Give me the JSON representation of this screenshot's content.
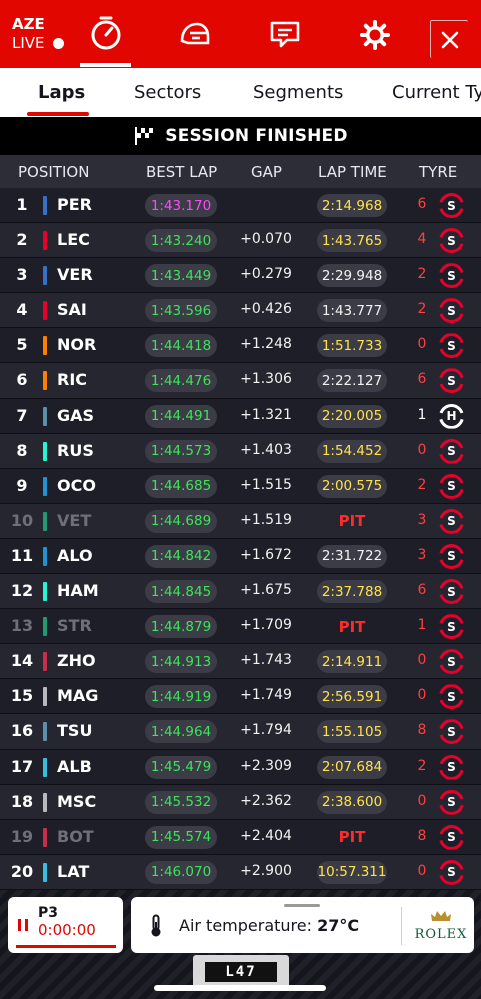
{
  "topbar": {
    "brand": "AZE",
    "live": "LIVE",
    "icons": [
      "timer-icon",
      "helmet-icon",
      "chat-icon",
      "gear-icon",
      "close-icon"
    ]
  },
  "tabs": [
    "Laps",
    "Sectors",
    "Segments",
    "Current Tyr"
  ],
  "banner": {
    "text": "SESSION FINISHED"
  },
  "table": {
    "headers": {
      "position": "POSITION",
      "best_lap": "BEST LAP",
      "gap": "GAP",
      "lap_time": "LAP TIME",
      "tyre": "TYRE"
    },
    "rows": [
      {
        "pos": "1",
        "code": "PER",
        "color": "#3671c6",
        "best": "1:43.170",
        "best_fastest": true,
        "gap": "",
        "lap": "2:14.968",
        "lap_pb": true,
        "pit": false,
        "age": "6",
        "tyre": "S",
        "dim": false
      },
      {
        "pos": "2",
        "code": "LEC",
        "color": "#e8002d",
        "best": "1:43.240",
        "best_fastest": false,
        "gap": "+0.070",
        "lap": "1:43.765",
        "lap_pb": true,
        "pit": false,
        "age": "4",
        "tyre": "S",
        "dim": false
      },
      {
        "pos": "3",
        "code": "VER",
        "color": "#3671c6",
        "best": "1:43.449",
        "best_fastest": false,
        "gap": "+0.279",
        "lap": "2:29.948",
        "lap_pb": false,
        "pit": false,
        "age": "2",
        "tyre": "S",
        "dim": false
      },
      {
        "pos": "4",
        "code": "SAI",
        "color": "#e8002d",
        "best": "1:43.596",
        "best_fastest": false,
        "gap": "+0.426",
        "lap": "1:43.777",
        "lap_pb": false,
        "pit": false,
        "age": "2",
        "tyre": "S",
        "dim": false
      },
      {
        "pos": "5",
        "code": "NOR",
        "color": "#ff8000",
        "best": "1:44.418",
        "best_fastest": false,
        "gap": "+1.248",
        "lap": "1:51.733",
        "lap_pb": true,
        "pit": false,
        "age": "0",
        "tyre": "S",
        "dim": false
      },
      {
        "pos": "6",
        "code": "RIC",
        "color": "#ff8000",
        "best": "1:44.476",
        "best_fastest": false,
        "gap": "+1.306",
        "lap": "2:22.127",
        "lap_pb": false,
        "pit": false,
        "age": "6",
        "tyre": "S",
        "dim": false
      },
      {
        "pos": "7",
        "code": "GAS",
        "color": "#5e8faa",
        "best": "1:44.491",
        "best_fastest": false,
        "gap": "+1.321",
        "lap": "2:20.005",
        "lap_pb": true,
        "pit": false,
        "age": "1",
        "tyre": "H",
        "dim": false
      },
      {
        "pos": "8",
        "code": "RUS",
        "color": "#27f4d2",
        "best": "1:44.573",
        "best_fastest": false,
        "gap": "+1.403",
        "lap": "1:54.452",
        "lap_pb": true,
        "pit": false,
        "age": "0",
        "tyre": "S",
        "dim": false
      },
      {
        "pos": "9",
        "code": "OCO",
        "color": "#2293d1",
        "best": "1:44.685",
        "best_fastest": false,
        "gap": "+1.515",
        "lap": "2:00.575",
        "lap_pb": true,
        "pit": false,
        "age": "2",
        "tyre": "S",
        "dim": false
      },
      {
        "pos": "10",
        "code": "VET",
        "color": "#229971",
        "best": "1:44.689",
        "best_fastest": false,
        "gap": "+1.519",
        "lap": "PIT",
        "lap_pb": false,
        "pit": true,
        "age": "3",
        "tyre": "S",
        "dim": true
      },
      {
        "pos": "11",
        "code": "ALO",
        "color": "#2293d1",
        "best": "1:44.842",
        "best_fastest": false,
        "gap": "+1.672",
        "lap": "2:31.722",
        "lap_pb": false,
        "pit": false,
        "age": "3",
        "tyre": "S",
        "dim": false
      },
      {
        "pos": "12",
        "code": "HAM",
        "color": "#27f4d2",
        "best": "1:44.845",
        "best_fastest": false,
        "gap": "+1.675",
        "lap": "2:37.788",
        "lap_pb": true,
        "pit": false,
        "age": "6",
        "tyre": "S",
        "dim": false
      },
      {
        "pos": "13",
        "code": "STR",
        "color": "#229971",
        "best": "1:44.879",
        "best_fastest": false,
        "gap": "+1.709",
        "lap": "PIT",
        "lap_pb": false,
        "pit": true,
        "age": "1",
        "tyre": "S",
        "dim": true
      },
      {
        "pos": "14",
        "code": "ZHO",
        "color": "#c92d4b",
        "best": "1:44.913",
        "best_fastest": false,
        "gap": "+1.743",
        "lap": "2:14.911",
        "lap_pb": true,
        "pit": false,
        "age": "0",
        "tyre": "S",
        "dim": false
      },
      {
        "pos": "15",
        "code": "MAG",
        "color": "#b6babd",
        "best": "1:44.919",
        "best_fastest": false,
        "gap": "+1.749",
        "lap": "2:56.591",
        "lap_pb": true,
        "pit": false,
        "age": "0",
        "tyre": "S",
        "dim": false
      },
      {
        "pos": "16",
        "code": "TSU",
        "color": "#5e8faa",
        "best": "1:44.964",
        "best_fastest": false,
        "gap": "+1.794",
        "lap": "1:55.105",
        "lap_pb": true,
        "pit": false,
        "age": "8",
        "tyre": "S",
        "dim": false
      },
      {
        "pos": "17",
        "code": "ALB",
        "color": "#37bedd",
        "best": "1:45.479",
        "best_fastest": false,
        "gap": "+2.309",
        "lap": "2:07.684",
        "lap_pb": true,
        "pit": false,
        "age": "2",
        "tyre": "S",
        "dim": false
      },
      {
        "pos": "18",
        "code": "MSC",
        "color": "#b6babd",
        "best": "1:45.532",
        "best_fastest": false,
        "gap": "+2.362",
        "lap": "2:38.600",
        "lap_pb": true,
        "pit": false,
        "age": "0",
        "tyre": "S",
        "dim": false
      },
      {
        "pos": "19",
        "code": "BOT",
        "color": "#c92d4b",
        "best": "1:45.574",
        "best_fastest": false,
        "gap": "+2.404",
        "lap": "PIT",
        "lap_pb": false,
        "pit": true,
        "age": "8",
        "tyre": "S",
        "dim": true
      },
      {
        "pos": "20",
        "code": "LAT",
        "color": "#37bedd",
        "best": "1:46.070",
        "best_fastest": false,
        "gap": "+2.900",
        "lap": "10:57.311",
        "lap_pb": true,
        "pit": false,
        "age": "0",
        "tyre": "S",
        "dim": false
      }
    ]
  },
  "session_card": {
    "label": "P3",
    "timer": "0:00:00"
  },
  "weather": {
    "label": "Air temperature:",
    "value": "27°C"
  },
  "sponsor": {
    "name": "ROLEX"
  },
  "car": {
    "plate": "L47"
  },
  "colors": {
    "accent": "#e10600",
    "fastest": "#ff47ff",
    "personal_best": "#ffe14a",
    "green": "#3de35a"
  }
}
